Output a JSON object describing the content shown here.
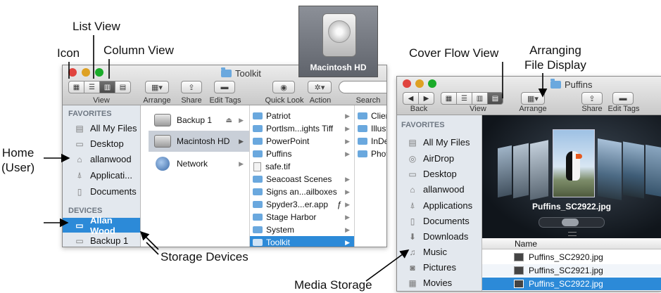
{
  "callouts": {
    "list_view": "List View",
    "icon": "Icon",
    "column_view": "Column View",
    "home_line1": "Home",
    "home_line2": "(User)",
    "storage_devices": "Storage Devices",
    "cover_flow_view": "Cover Flow View",
    "arranging_line1": "Arranging",
    "arranging_line2": "File Display",
    "media_storage": "Media Storage"
  },
  "desktop_icon": {
    "label": "Macintosh HD"
  },
  "toolkit_window": {
    "title": "Toolkit",
    "toolbar_labels": {
      "view": "View",
      "arrange": "Arrange",
      "share": "Share",
      "edit_tags": "Edit Tags",
      "quick_look": "Quick Look",
      "action": "Action",
      "search": "Search"
    },
    "sidebar": {
      "favorites_header": "FAVORITES",
      "favorites": [
        "All My Files",
        "Desktop",
        "allanwood",
        "Applicati...",
        "Documents"
      ],
      "devices_header": "DEVICES",
      "devices": [
        "Allan Wood",
        "Backup 1"
      ]
    },
    "column1": [
      {
        "label": "Backup 1"
      },
      {
        "label": "Macintosh HD"
      },
      {
        "label": "Network"
      }
    ],
    "column2": [
      "Patriot",
      "Portlsm...ights Tiff",
      "PowerPoint",
      "Puffins",
      "safe.tif",
      "Seacoast Scenes",
      "Signs an...ailboxes",
      "Spyder3...er.app",
      "Stage Harbor",
      "System",
      "Toolkit"
    ],
    "column2_alias_mark": "ƒ",
    "column3": [
      "Client",
      "Illustr",
      "InDes",
      "Photo"
    ]
  },
  "puffins_window": {
    "title": "Puffins",
    "toolbar_labels": {
      "back": "Back",
      "view": "View",
      "arrange": "Arrange",
      "share": "Share",
      "edit_tags": "Edit Tags"
    },
    "sidebar": {
      "favorites_header": "FAVORITES",
      "items": [
        "All My Files",
        "AirDrop",
        "Desktop",
        "allanwood",
        "Applications",
        "Documents",
        "Downloads",
        "Music",
        "Pictures",
        "Movies"
      ]
    },
    "cover_flow_caption": "Puffins_SC2922.jpg",
    "list_header": "Name",
    "files": [
      "Puffins_SC2920.jpg",
      "Puffins_SC2921.jpg",
      "Puffins_SC2922.jpg"
    ]
  },
  "colors": {
    "selection": "#2c8ad8",
    "sidebar": "#e3e8ee",
    "cover_flow_bg": "#1b2028"
  }
}
